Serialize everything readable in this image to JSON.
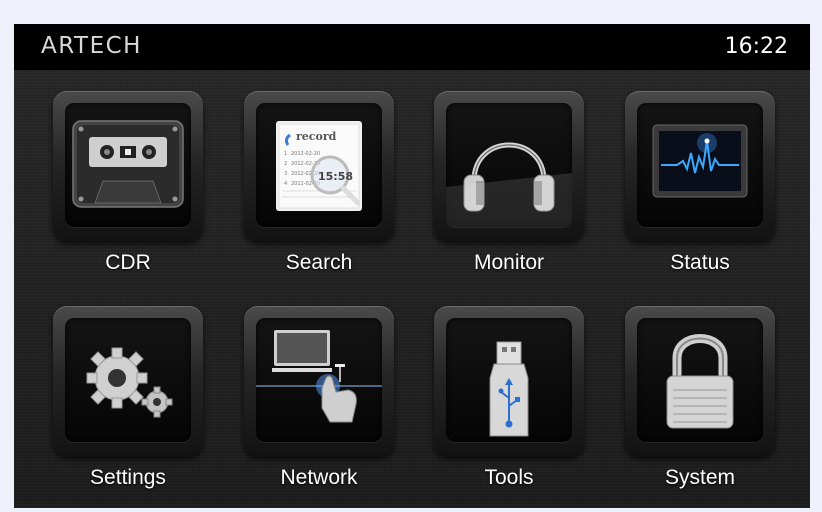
{
  "header": {
    "brand": "ARTECH",
    "time": "16:22"
  },
  "apps": [
    {
      "label": "CDR",
      "icon": "cassette-tape-icon"
    },
    {
      "label": "Search",
      "icon": "record-search-icon"
    },
    {
      "label": "Monitor",
      "icon": "headphones-icon"
    },
    {
      "label": "Status",
      "icon": "waveform-monitor-icon"
    },
    {
      "label": "Settings",
      "icon": "gears-icon"
    },
    {
      "label": "Network",
      "icon": "network-touch-icon"
    },
    {
      "label": "Tools",
      "icon": "usb-drive-icon"
    },
    {
      "label": "System",
      "icon": "padlock-icon"
    }
  ],
  "search_icon_text": {
    "title": "record",
    "rows": [
      {
        "num": "1",
        "date": "2012-02-20"
      },
      {
        "num": "2",
        "date": "2012-02-20"
      },
      {
        "num": "3",
        "date": "2012-02-20"
      },
      {
        "num": "4",
        "date": "2012-02-20"
      }
    ],
    "magnified_time": "15:58"
  },
  "colors": {
    "screen_bg": "#1d1d1d",
    "topbar_bg": "#000000",
    "status_wave": "#3aa8ff"
  }
}
